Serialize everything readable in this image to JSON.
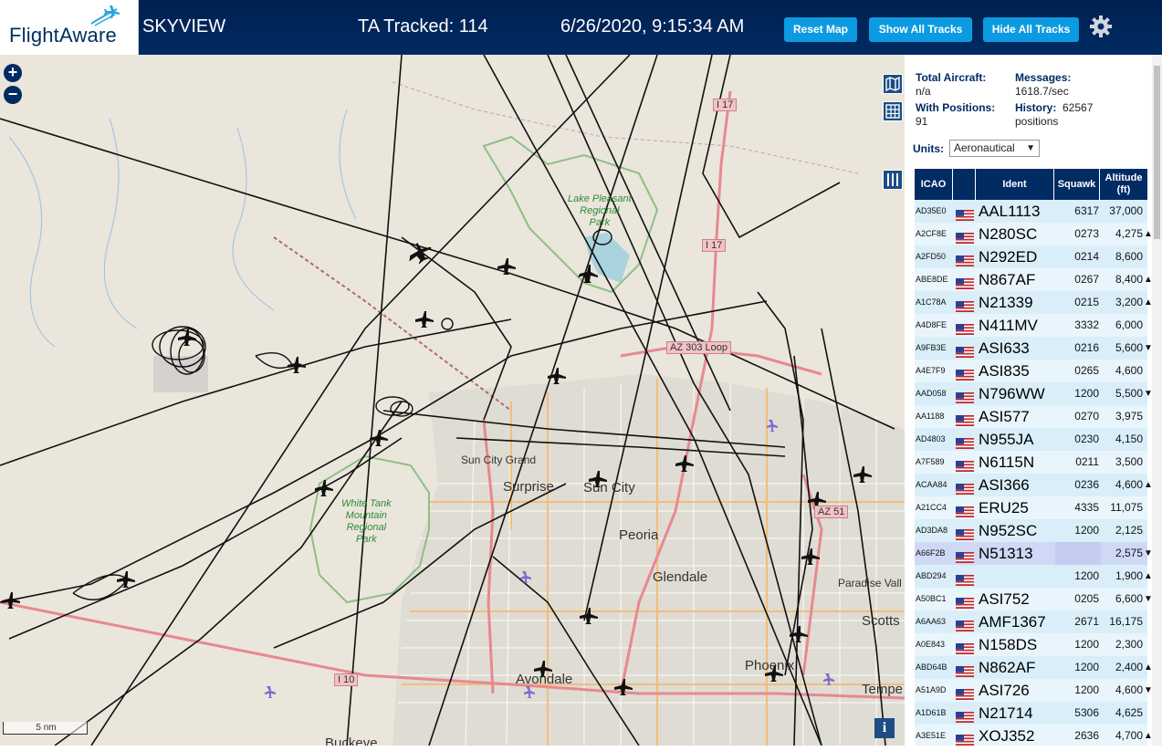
{
  "header": {
    "logo": "FlightAware",
    "app_title": "SKYVIEW",
    "tracked": "TA Tracked: 114",
    "datetime": "6/26/2020, 9:15:34 AM",
    "buttons": {
      "reset": "Reset Map",
      "show_all": "Show All Tracks",
      "hide_all": "Hide All Tracks"
    },
    "brand_color": "#002b63",
    "button_color": "#0c9ae1"
  },
  "map": {
    "zoom_in": "+",
    "zoom_out": "−",
    "scale": "5 nm",
    "info": "i",
    "labels": {
      "sun_city_grand": "Sun City Grand",
      "surprise": "Surprise",
      "sun_city": "Sun City",
      "peoria": "Peoria",
      "glendale": "Glendale",
      "phoenix": "Phoenix",
      "avondale": "Avondale",
      "buckeye": "Buckeye",
      "scottsdale": "Scotts",
      "paradise_valley": "Paradise Vall",
      "tempe": "Tempe",
      "lake_pleasant_1": "Lake Pleasant",
      "lake_pleasant_2": "Regional",
      "lake_pleasant_3": "Park",
      "white_tank_1": "White Tank",
      "white_tank_2": "Mountain",
      "white_tank_3": "Regional",
      "white_tank_4": "Park",
      "i17_north": "I 17",
      "i17_mid": "I 17",
      "az303": "AZ 303 Loop",
      "i10": "I 10",
      "az51": "AZ 51"
    }
  },
  "stats": {
    "total_label": "Total Aircraft:",
    "total_value": "n/a",
    "messages_label": "Messages:",
    "messages_value": "1618.7/sec",
    "with_positions_label": "With Positions:",
    "with_positions_value": "91",
    "history_label": "History:",
    "history_value": "62567",
    "history_unit": "positions"
  },
  "units": {
    "label": "Units:",
    "selected": "Aeronautical"
  },
  "table": {
    "headers": {
      "icao": "ICAO",
      "ident": "Ident",
      "squawk": "Squawk",
      "altitude": "Altitude (ft)"
    },
    "rows": [
      {
        "icao": "AD35E0",
        "ident": "AAL1113",
        "squawk": "6317",
        "alt": "37,000",
        "trend": ""
      },
      {
        "icao": "A2CF8E",
        "ident": "N280SC",
        "squawk": "0273",
        "alt": "4,275",
        "trend": "▲"
      },
      {
        "icao": "A2FD50",
        "ident": "N292ED",
        "squawk": "0214",
        "alt": "8,600",
        "trend": ""
      },
      {
        "icao": "ABE8DE",
        "ident": "N867AF",
        "squawk": "0267",
        "alt": "8,400",
        "trend": "▲"
      },
      {
        "icao": "A1C78A",
        "ident": "N21339",
        "squawk": "0215",
        "alt": "3,200",
        "trend": "▲"
      },
      {
        "icao": "A4D8FE",
        "ident": "N411MV",
        "squawk": "3332",
        "alt": "6,000",
        "trend": ""
      },
      {
        "icao": "A9FB3E",
        "ident": "ASI633",
        "squawk": "0216",
        "alt": "5,600",
        "trend": "▼"
      },
      {
        "icao": "A4E7F9",
        "ident": "ASI835",
        "squawk": "0265",
        "alt": "4,600",
        "trend": ""
      },
      {
        "icao": "AAD058",
        "ident": "N796WW",
        "squawk": "1200",
        "alt": "5,500",
        "trend": "▼"
      },
      {
        "icao": "AA1188",
        "ident": "ASI577",
        "squawk": "0270",
        "alt": "3,975",
        "trend": ""
      },
      {
        "icao": "AD4803",
        "ident": "N955JA",
        "squawk": "0230",
        "alt": "4,150",
        "trend": ""
      },
      {
        "icao": "A7F589",
        "ident": "N6115N",
        "squawk": "0211",
        "alt": "3,500",
        "trend": ""
      },
      {
        "icao": "ACAA84",
        "ident": "ASI366",
        "squawk": "0236",
        "alt": "4,600",
        "trend": "▲"
      },
      {
        "icao": "A21CC4",
        "ident": "ERU25",
        "squawk": "4335",
        "alt": "11,075",
        "trend": ""
      },
      {
        "icao": "AD3DA8",
        "ident": "N952SC",
        "squawk": "1200",
        "alt": "2,125",
        "trend": ""
      },
      {
        "icao": "A66F2B",
        "ident": "N51313",
        "squawk": "",
        "alt": "2,575",
        "trend": "▼"
      },
      {
        "icao": "ABD294",
        "ident": "",
        "squawk": "1200",
        "alt": "1,900",
        "trend": "▲"
      },
      {
        "icao": "A50BC1",
        "ident": "ASI752",
        "squawk": "0205",
        "alt": "6,600",
        "trend": "▼"
      },
      {
        "icao": "A6AA63",
        "ident": "AMF1367",
        "squawk": "2671",
        "alt": "16,175",
        "trend": ""
      },
      {
        "icao": "A0E843",
        "ident": "N158DS",
        "squawk": "1200",
        "alt": "2,300",
        "trend": ""
      },
      {
        "icao": "ABD64B",
        "ident": "N862AF",
        "squawk": "1200",
        "alt": "2,400",
        "trend": "▲"
      },
      {
        "icao": "A51A9D",
        "ident": "ASI726",
        "squawk": "1200",
        "alt": "4,600",
        "trend": "▼"
      },
      {
        "icao": "A1D61B",
        "ident": "N21714",
        "squawk": "5306",
        "alt": "4,625",
        "trend": ""
      },
      {
        "icao": "A3E51E",
        "ident": "XOJ352",
        "squawk": "2636",
        "alt": "4,700",
        "trend": "▲"
      }
    ],
    "selected_row": 15
  }
}
